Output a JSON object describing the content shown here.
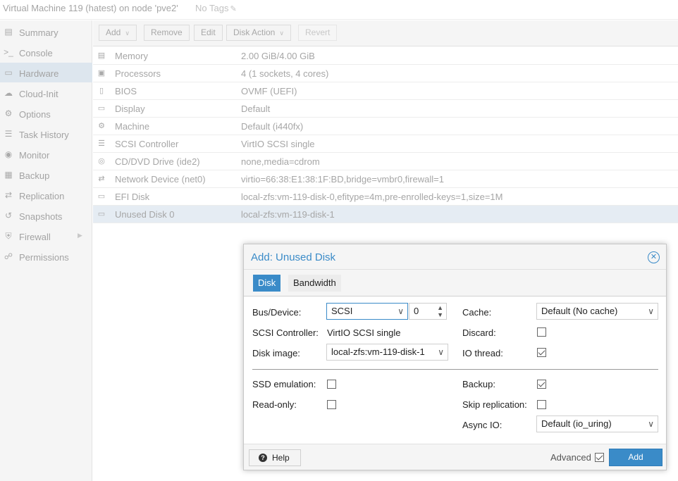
{
  "window": {
    "title": "Virtual Machine 119 (hatest) on node 'pve2'",
    "tags": "No Tags"
  },
  "sidebar": {
    "items": [
      {
        "label": "Summary",
        "icon": "book-icon"
      },
      {
        "label": "Console",
        "icon": "terminal-icon"
      },
      {
        "label": "Hardware",
        "icon": "desktop-icon",
        "active": true
      },
      {
        "label": "Cloud-Init",
        "icon": "cloud-icon"
      },
      {
        "label": "Options",
        "icon": "gear-icon"
      },
      {
        "label": "Task History",
        "icon": "list-icon"
      },
      {
        "label": "Monitor",
        "icon": "eye-icon"
      },
      {
        "label": "Backup",
        "icon": "floppy-icon"
      },
      {
        "label": "Replication",
        "icon": "retweet-icon"
      },
      {
        "label": "Snapshots",
        "icon": "history-icon"
      },
      {
        "label": "Firewall",
        "icon": "shield-icon"
      },
      {
        "label": "Permissions",
        "icon": "unlock-icon"
      }
    ]
  },
  "toolbar": {
    "add": "Add",
    "remove": "Remove",
    "edit": "Edit",
    "disk_action": "Disk Action",
    "revert": "Revert"
  },
  "hardware": {
    "rows": [
      {
        "name": "Memory",
        "value": "2.00 GiB/4.00 GiB",
        "icon": "memory-icon"
      },
      {
        "name": "Processors",
        "value": "4 (1 sockets, 4 cores)",
        "icon": "cpu-icon"
      },
      {
        "name": "BIOS",
        "value": "OVMF (UEFI)",
        "icon": "microchip-icon"
      },
      {
        "name": "Display",
        "value": "Default",
        "icon": "desktop-icon"
      },
      {
        "name": "Machine",
        "value": "Default (i440fx)",
        "icon": "cogs-icon"
      },
      {
        "name": "SCSI Controller",
        "value": "VirtIO SCSI single",
        "icon": "database-icon"
      },
      {
        "name": "CD/DVD Drive (ide2)",
        "value": "none,media=cdrom",
        "icon": "cdrom-icon"
      },
      {
        "name": "Network Device (net0)",
        "value": "virtio=66:38:E1:38:1F:BD,bridge=vmbr0,firewall=1",
        "icon": "exchange-icon"
      },
      {
        "name": "EFI Disk",
        "value": "local-zfs:vm-119-disk-0,efitype=4m,pre-enrolled-keys=1,size=1M",
        "icon": "hdd-icon"
      },
      {
        "name": "Unused Disk 0",
        "value": "local-zfs:vm-119-disk-1",
        "icon": "hdd-icon",
        "selected": true
      }
    ]
  },
  "dialog": {
    "title": "Add: Unused Disk",
    "tabs": {
      "disk": "Disk",
      "bandwidth": "Bandwidth"
    },
    "fields": {
      "bus_device_label": "Bus/Device:",
      "bus_value": "SCSI",
      "device_number": "0",
      "scsi_controller_label": "SCSI Controller:",
      "scsi_controller_value": "VirtIO SCSI single",
      "disk_image_label": "Disk image:",
      "disk_image_value": "local-zfs:vm-119-disk-1",
      "cache_label": "Cache:",
      "cache_value": "Default (No cache)",
      "discard_label": "Discard:",
      "io_thread_label": "IO thread:",
      "ssd_emulation_label": "SSD emulation:",
      "read_only_label": "Read-only:",
      "backup_label": "Backup:",
      "skip_replication_label": "Skip replication:",
      "async_io_label": "Async IO:",
      "async_io_value": "Default (io_uring)"
    },
    "checks": {
      "discard": false,
      "io_thread": true,
      "ssd_emulation": false,
      "read_only": false,
      "backup": true,
      "skip_replication": false,
      "advanced": true
    },
    "footer": {
      "help": "Help",
      "advanced": "Advanced",
      "add": "Add"
    }
  },
  "colors": {
    "accent": "#3a8bc8",
    "selected_row": "#e5ecf3",
    "active_nav": "#dde6ee"
  }
}
